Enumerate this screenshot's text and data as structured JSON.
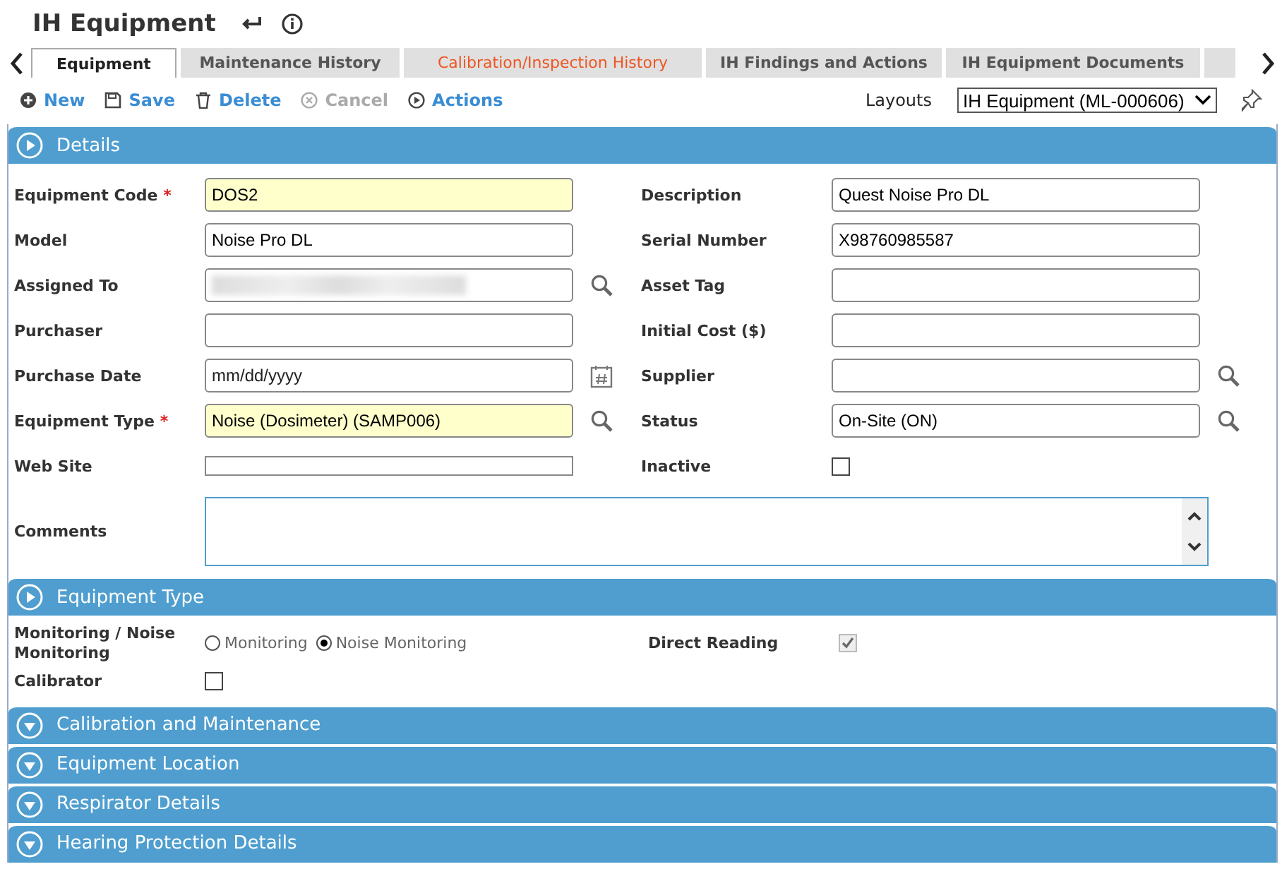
{
  "header": {
    "title": "IH Equipment"
  },
  "tabs": [
    {
      "label": "Equipment",
      "selected": true,
      "alert": false
    },
    {
      "label": "Maintenance History",
      "selected": false,
      "alert": false
    },
    {
      "label": "Calibration/Inspection History",
      "selected": false,
      "alert": true
    },
    {
      "label": "IH Findings and Actions",
      "selected": false,
      "alert": false
    },
    {
      "label": "IH Equipment Documents",
      "selected": false,
      "alert": false
    }
  ],
  "toolbar": {
    "actions": [
      {
        "label": "New",
        "kind": "new",
        "disabled": false
      },
      {
        "label": "Save",
        "kind": "save",
        "disabled": false
      },
      {
        "label": "Delete",
        "kind": "delete",
        "disabled": false
      },
      {
        "label": "Cancel",
        "kind": "cancel",
        "disabled": true
      },
      {
        "label": "Actions",
        "kind": "actions",
        "disabled": false
      }
    ],
    "layouts_label": "Layouts",
    "layout_value": "IH Equipment (ML-000606)"
  },
  "sections": [
    {
      "title": "Details",
      "expanded": true,
      "kind": "details",
      "rows": [
        {
          "left": {
            "label": "Equipment Code",
            "required_mark": "*",
            "kind": "text",
            "value": "DOS2"
          },
          "right": {
            "label": "Description",
            "kind": "text",
            "value": "Quest Noise Pro DL"
          }
        },
        {
          "left": {
            "label": "Model",
            "kind": "text",
            "value": "Noise Pro DL"
          },
          "right": {
            "label": "Serial Number",
            "kind": "text",
            "value": "X98760985587"
          }
        },
        {
          "left": {
            "label": "Assigned To",
            "kind": "redacted",
            "lookup": true
          },
          "right": {
            "label": "Asset Tag",
            "kind": "text"
          }
        },
        {
          "left": {
            "label": "Purchaser",
            "kind": "text"
          },
          "right": {
            "label": "Initial Cost ($)",
            "kind": "text"
          }
        },
        {
          "left": {
            "label": "Purchase Date",
            "kind": "text",
            "placeholder": "mm/dd/yyyy",
            "calendar": true
          },
          "right": {
            "label": "Supplier",
            "kind": "text",
            "lookup": true
          }
        },
        {
          "left": {
            "label": "Equipment Type",
            "required_mark": "*",
            "kind": "text",
            "value": "Noise (Dosimeter) (SAMP006)",
            "lookup": true
          },
          "right": {
            "label": "Status",
            "kind": "text",
            "value": "On-Site (ON)",
            "lookup": true
          }
        },
        {
          "left": {
            "label": "Web Site",
            "kind": "short"
          },
          "right": {
            "label": "Inactive",
            "kind": "checkbox",
            "checked": false
          }
        }
      ],
      "comments": {
        "label": "Comments"
      }
    },
    {
      "title": "Equipment Type",
      "expanded": true,
      "kind": "equipment_type",
      "radio_group": {
        "label": "Monitoring / Noise Monitoring",
        "options": [
          {
            "label": "Monitoring",
            "selected": false
          },
          {
            "label": "Noise Monitoring",
            "selected": true
          }
        ]
      },
      "direct_reading": {
        "label": "Direct Reading",
        "checked": true,
        "disabled": true
      },
      "calibrator": {
        "label": "Calibrator",
        "checked": false
      }
    },
    {
      "title": "Calibration and Maintenance",
      "expanded": false
    },
    {
      "title": "Equipment Location",
      "expanded": false
    },
    {
      "title": "Respirator Details",
      "expanded": false
    },
    {
      "title": "Hearing Protection Details",
      "expanded": false
    }
  ]
}
